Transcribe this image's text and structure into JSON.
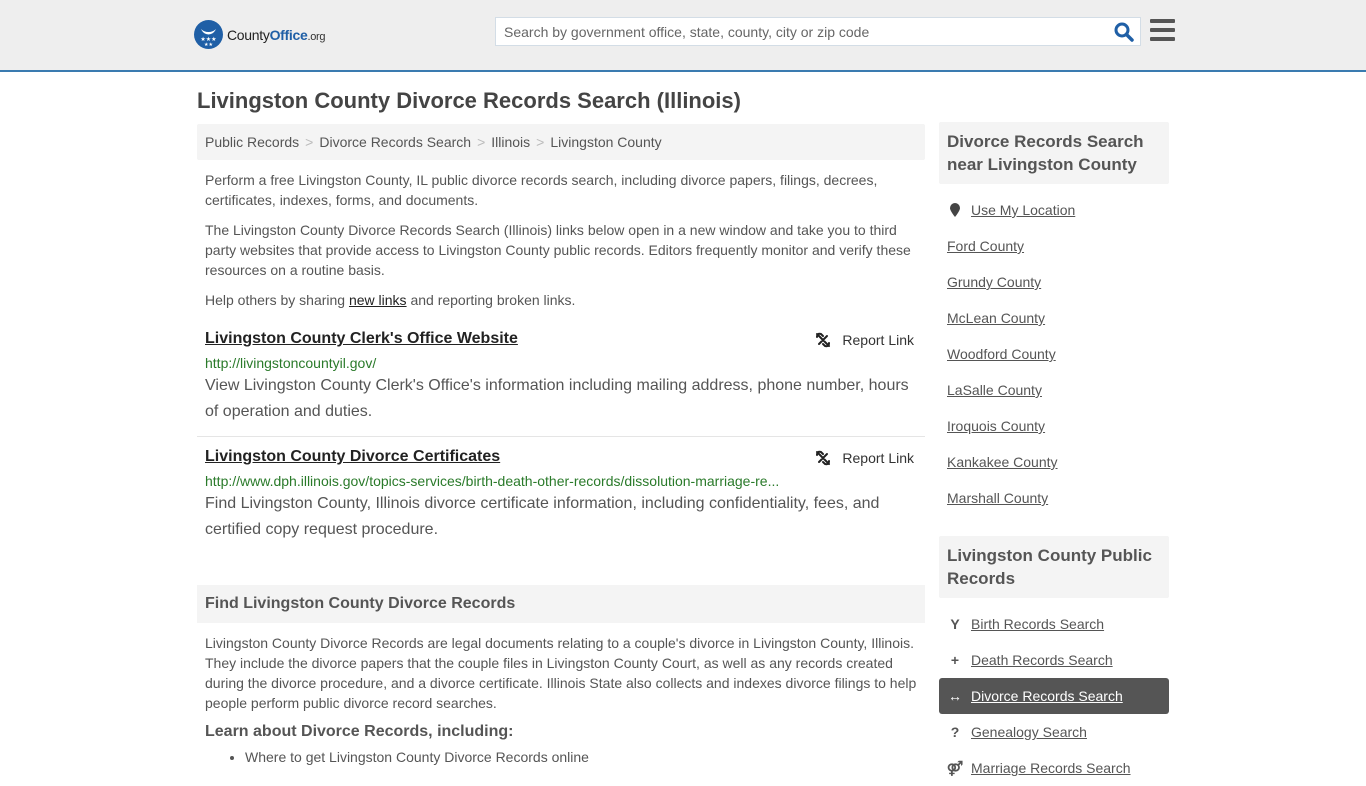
{
  "header": {
    "logo_text_main": "County",
    "logo_text_accent": "Office",
    "logo_text_tld": ".org",
    "search_placeholder": "Search by government office, state, county, city or zip code",
    "search_icon": "search-icon",
    "menu_icon": "hamburger-menu-icon"
  },
  "page": {
    "title": "Livingston County Divorce Records Search (Illinois)"
  },
  "breadcrumb": [
    {
      "label": "Public Records"
    },
    {
      "label": "Divorce Records Search"
    },
    {
      "label": "Illinois"
    },
    {
      "label": "Livingston County"
    }
  ],
  "intro": {
    "p1": "Perform a free Livingston County, IL public divorce records search, including divorce papers, filings, decrees, certificates, indexes, forms, and documents.",
    "p2": "The Livingston County Divorce Records Search (Illinois) links below open in a new window and take you to third party websites that provide access to Livingston County public records. Editors frequently monitor and verify these resources on a routine basis.",
    "p3_before": "Help others by sharing ",
    "p3_link": "new links",
    "p3_after": " and reporting broken links."
  },
  "links": [
    {
      "title": "Livingston County Clerk's Office Website",
      "url": "http://livingstoncountyil.gov/",
      "description": "View Livingston County Clerk's Office's information including mailing address, phone number, hours of operation and duties.",
      "report_label": "Report Link"
    },
    {
      "title": "Livingston County Divorce Certificates",
      "url": "http://www.dph.illinois.gov/topics-services/birth-death-other-records/dissolution-marriage-re...",
      "description": "Find Livingston County, Illinois divorce certificate information, including confidentiality, fees, and certified copy request procedure.",
      "report_label": "Report Link"
    }
  ],
  "find_section": {
    "heading": "Find Livingston County Divorce Records",
    "body": "Livingston County Divorce Records are legal documents relating to a couple's divorce in Livingston County, Illinois. They include the divorce papers that the couple files in Livingston County Court, as well as any records created during the divorce procedure, and a divorce certificate. Illinois State also collects and indexes divorce filings to help people perform public divorce record searches.",
    "learn_heading": "Learn about Divorce Records, including:",
    "bullets": [
      "Where to get Livingston County Divorce Records online"
    ]
  },
  "sidebar": {
    "nearby_heading": "Divorce Records Search near Livingston County",
    "use_location": "Use My Location",
    "nearby": [
      "Ford County",
      "Grundy County",
      "McLean County",
      "Woodford County",
      "LaSalle County",
      "Iroquois County",
      "Kankakee County",
      "Marshall County"
    ],
    "public_heading": "Livingston County Public Records",
    "public_records": [
      {
        "label": "Birth Records Search",
        "icon": "child-icon",
        "glyph": "Y",
        "active": false
      },
      {
        "label": "Death Records Search",
        "icon": "plus-icon",
        "glyph": "+",
        "active": false
      },
      {
        "label": "Divorce Records Search",
        "icon": "arrows-horizontal-icon",
        "glyph": "↔",
        "active": true
      },
      {
        "label": "Genealogy Search",
        "icon": "question-icon",
        "glyph": "?",
        "active": false
      },
      {
        "label": "Marriage Records Search",
        "icon": "gender-icon",
        "glyph": "⚤",
        "active": false
      }
    ]
  },
  "colors": {
    "brand_blue": "#1f5fa6",
    "header_border": "#3a7bb0",
    "url_green": "#2a7a2a",
    "active_bg": "#555555"
  }
}
